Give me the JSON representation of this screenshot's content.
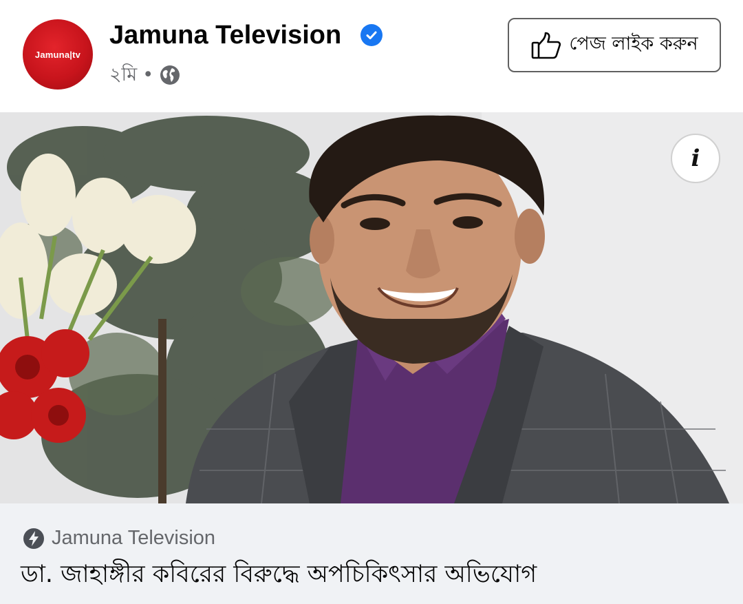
{
  "post": {
    "page_name": "Jamuna Television",
    "avatar_text": "Jamuna|tv",
    "time": "২মি",
    "separator": "•",
    "audience_icon": "globe-icon",
    "verified_icon": "verified-badge-icon",
    "like_button_label": "পেজ লাইক করুন",
    "like_icon": "thumbs-up-icon",
    "info_label": "i"
  },
  "link": {
    "source_icon": "bolt-icon",
    "source": "Jamuna Television",
    "headline": "ডা. জাহাঙ্গীর কবিরের বিরুদ্ধে অপচিকিৎসার অভিযোগ"
  },
  "colors": {
    "brand_red": "#c8141c",
    "verified_blue": "#1877f2",
    "link_bar_bg": "#f0f2f5",
    "meta_gray": "#65676b"
  }
}
